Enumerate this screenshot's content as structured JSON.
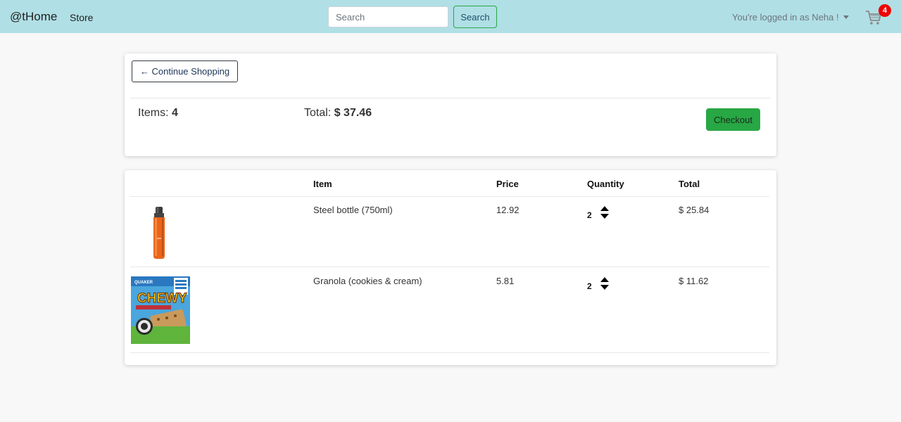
{
  "header": {
    "brand": "@tHome",
    "nav_store": "Store",
    "search_placeholder": "Search",
    "search_button": "Search",
    "user_menu": "You're logged in as Neha !",
    "cart_count": "4"
  },
  "summary": {
    "continue_label": "← Continue Shopping",
    "items_label": "Items:",
    "items_value": "4",
    "total_label": "Total:",
    "total_value": "$ 37.46",
    "checkout_label": "Checkout"
  },
  "table": {
    "headers": {
      "item": "Item",
      "price": "Price",
      "quantity": "Quantity",
      "total": "Total"
    },
    "rows": [
      {
        "name": "Steel bottle (750ml)",
        "price": "12.92",
        "quantity": "2",
        "total": "$ 25.84",
        "image": "steel-bottle-image"
      },
      {
        "name": "Granola (cookies & cream)",
        "price": "5.81",
        "quantity": "2",
        "total": "$ 11.62",
        "image": "granola-box-image"
      }
    ]
  },
  "colors": {
    "navbar": "#b0dfe5",
    "success": "#28a745",
    "badge": "#e00000",
    "background": "#f8f8f8"
  },
  "images": {
    "bottle_label": "",
    "granola_brand": "CHEWY",
    "granola_maker": "QUAKER"
  }
}
